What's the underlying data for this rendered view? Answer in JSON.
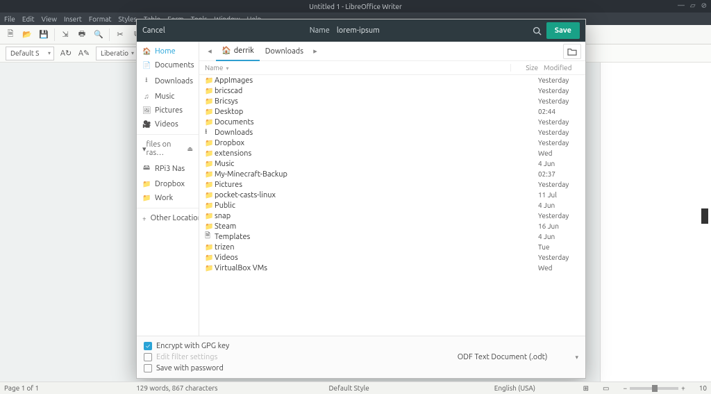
{
  "window": {
    "title": "Untitled 1 - LibreOffice Writer"
  },
  "menus": [
    "File",
    "Edit",
    "View",
    "Insert",
    "Format",
    "Styles",
    "Table",
    "Form",
    "Tools",
    "Window",
    "Help"
  ],
  "format": {
    "styleName": "Default S",
    "fontName": "Liberatio"
  },
  "dialog": {
    "cancel": "Cancel",
    "nameLabel": "Name",
    "filename": "lorem-ipsum",
    "save": "Save",
    "breadcrumbs": [
      {
        "label": "derrik",
        "icon": "home",
        "active": true
      },
      {
        "label": "Downloads",
        "icon": "",
        "active": false
      }
    ],
    "columns": {
      "name": "Name",
      "size": "Size",
      "modified": "Modified"
    },
    "sidebar": {
      "places": [
        {
          "label": "Home",
          "icon": "🏠",
          "active": true
        },
        {
          "label": "Documents",
          "icon": "📄"
        },
        {
          "label": "Downloads",
          "icon": "⭳"
        },
        {
          "label": "Music",
          "icon": "♫"
        },
        {
          "label": "Pictures",
          "icon": "🖼"
        },
        {
          "label": "Videos",
          "icon": "🎥"
        }
      ],
      "mountsHeader": "files on ras…",
      "mounts": [
        {
          "label": "RPi3 Nas",
          "icon": "🖴"
        },
        {
          "label": "Dropbox",
          "icon": "📁"
        },
        {
          "label": "Work",
          "icon": "📁"
        }
      ],
      "other": "Other Locations"
    },
    "files": [
      {
        "name": "AppImages",
        "icon": "📁",
        "mod": "Yesterday"
      },
      {
        "name": "bricscad",
        "icon": "📁",
        "mod": "Yesterday"
      },
      {
        "name": "Bricsys",
        "icon": "📁",
        "mod": "Yesterday"
      },
      {
        "name": "Desktop",
        "icon": "📁",
        "mod": "02:44"
      },
      {
        "name": "Documents",
        "icon": "📁",
        "mod": "Yesterday"
      },
      {
        "name": "Downloads",
        "icon": "⭳",
        "mod": "Yesterday"
      },
      {
        "name": "Dropbox",
        "icon": "📁",
        "mod": "Yesterday"
      },
      {
        "name": "extensions",
        "icon": "📁",
        "mod": "Wed"
      },
      {
        "name": "Music",
        "icon": "📁",
        "mod": "4 Jun"
      },
      {
        "name": "My-Minecraft-Backup",
        "icon": "📁",
        "mod": "02:37"
      },
      {
        "name": "Pictures",
        "icon": "📁",
        "mod": "Yesterday"
      },
      {
        "name": "pocket-casts-linux",
        "icon": "📁",
        "mod": "11 Jul"
      },
      {
        "name": "Public",
        "icon": "📁",
        "mod": "4 Jun"
      },
      {
        "name": "snap",
        "icon": "📁",
        "mod": "Yesterday"
      },
      {
        "name": "Steam",
        "icon": "📁",
        "mod": "16 Jun"
      },
      {
        "name": "Templates",
        "icon": "🗎",
        "mod": "4 Jun"
      },
      {
        "name": "trizen",
        "icon": "📁",
        "mod": "Tue"
      },
      {
        "name": "Videos",
        "icon": "📁",
        "mod": "Yesterday"
      },
      {
        "name": "VirtualBox VMs",
        "icon": "📁",
        "mod": "Wed"
      }
    ],
    "options": {
      "encrypt": "Encrypt with GPG key",
      "filter": "Edit filter settings",
      "password": "Save with password",
      "format": "ODF Text Document (.odt)"
    }
  },
  "status": {
    "page": "Page 1 of 1",
    "words": "129 words, 867 characters",
    "style": "Default Style",
    "lang": "English (USA)",
    "zoom": "10"
  }
}
